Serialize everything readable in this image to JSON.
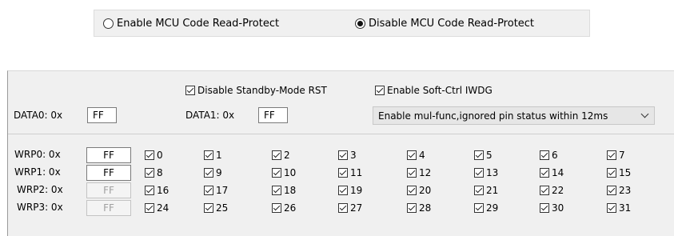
{
  "read_protect": {
    "enable_label": "Enable MCU Code Read-Protect",
    "disable_label": "Disable MCU Code Read-Protect",
    "selected": "disable"
  },
  "options": {
    "standby_label": "Disable Standby-Mode RST",
    "standby_checked": true,
    "iwdg_label": "Enable Soft-Ctrl IWDG",
    "iwdg_checked": true,
    "data0_label": "DATA0: 0x",
    "data0_value": "FF",
    "data1_label": "DATA1: 0x",
    "data1_value": "FF",
    "mode_select": "Enable mul-func,ignored pin status within 12ms"
  },
  "wrp": {
    "rows": [
      {
        "label": "WRP0: 0x",
        "value": "FF",
        "enabled": true,
        "bits": [
          "0",
          "1",
          "2",
          "3",
          "4",
          "5",
          "6",
          "7"
        ]
      },
      {
        "label": "WRP1: 0x",
        "value": "FF",
        "enabled": true,
        "bits": [
          "8",
          "9",
          "10",
          "11",
          "12",
          "13",
          "14",
          "15"
        ]
      },
      {
        "label": "WRP2: 0x",
        "value": "FF",
        "enabled": false,
        "bits": [
          "16",
          "17",
          "18",
          "19",
          "20",
          "21",
          "22",
          "23"
        ]
      },
      {
        "label": "WRP3: 0x",
        "value": "FF",
        "enabled": false,
        "bits": [
          "24",
          "25",
          "26",
          "27",
          "28",
          "29",
          "30",
          "31"
        ]
      }
    ]
  }
}
